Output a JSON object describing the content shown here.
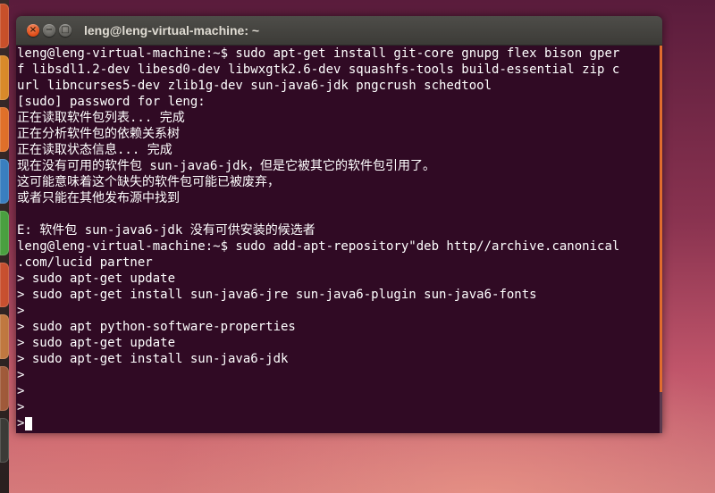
{
  "window": {
    "title": "leng@leng-virtual-machine: ~",
    "close_glyph": "×",
    "minimize_glyph": "−",
    "maximize_glyph": "□"
  },
  "terminal": {
    "colors": {
      "background": "#300a24",
      "foreground": "#ffffff",
      "accent": "#dd4814"
    },
    "lines": [
      "leng@leng-virtual-machine:~$ sudo apt-get install git-core gnupg flex bison gper",
      "f libsdl1.2-dev libesd0-dev libwxgtk2.6-dev squashfs-tools build-essential zip c",
      "url libncurses5-dev zlib1g-dev sun-java6-jdk pngcrush schedtool",
      "[sudo] password for leng:",
      "正在读取软件包列表... 完成",
      "正在分析软件包的依赖关系树",
      "正在读取状态信息... 完成",
      "现在没有可用的软件包 sun-java6-jdk，但是它被其它的软件包引用了。",
      "这可能意味着这个缺失的软件包可能已被废弃，",
      "或者只能在其他发布源中找到",
      "",
      "E: 软件包 sun-java6-jdk 没有可供安装的候选者",
      "leng@leng-virtual-machine:~$ sudo add-apt-repository\"deb http//archive.canonical",
      ".com/lucid partner",
      "> sudo apt-get update",
      "> sudo apt-get install sun-java6-jre sun-java6-plugin sun-java6-fonts",
      ">",
      "> sudo apt python-software-properties",
      "> sudo apt-get update",
      "> sudo apt-get install sun-java6-jdk",
      ">",
      ">",
      ">",
      ">"
    ]
  },
  "launcher": {
    "items": [
      {
        "icon": "dash-icon",
        "color": "#c8502a"
      },
      {
        "icon": "files-icon",
        "color": "#d98a2a"
      },
      {
        "icon": "firefox-icon",
        "color": "#e0702a"
      },
      {
        "icon": "app-icon",
        "color": "#3a7fc0"
      },
      {
        "icon": "app-icon",
        "color": "#3a6fa8"
      },
      {
        "icon": "office-icon",
        "color": "#4aa040"
      },
      {
        "icon": "office-icon",
        "color": "#c85030"
      },
      {
        "icon": "software-center-icon",
        "color": "#c07840"
      },
      {
        "icon": "settings-icon",
        "color": "#8a6a50"
      },
      {
        "icon": "terminal-icon",
        "color": "#3c3b37"
      }
    ]
  }
}
